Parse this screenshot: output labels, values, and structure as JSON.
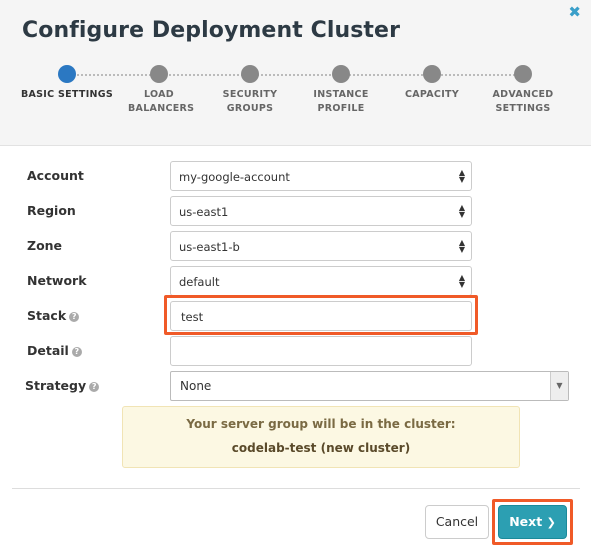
{
  "header": {
    "title": "Configure Deployment Cluster",
    "close_icon": "close-icon"
  },
  "wizard": {
    "steps": [
      {
        "label": "BASIC SETTINGS",
        "active": true
      },
      {
        "label": "LOAD BALANCERS",
        "active": false
      },
      {
        "label": "SECURITY GROUPS",
        "active": false
      },
      {
        "label": "INSTANCE PROFILE",
        "active": false
      },
      {
        "label": "CAPACITY",
        "active": false
      },
      {
        "label": "ADVANCED SETTINGS",
        "active": false
      }
    ]
  },
  "form": {
    "account": {
      "label": "Account",
      "value": "my-google-account"
    },
    "region": {
      "label": "Region",
      "value": "us-east1"
    },
    "zone": {
      "label": "Zone",
      "value": "us-east1-b"
    },
    "network": {
      "label": "Network",
      "value": "default"
    },
    "stack": {
      "label": "Stack",
      "value": "test"
    },
    "detail": {
      "label": "Detail",
      "value": ""
    },
    "strategy": {
      "label": "Strategy",
      "value": "None"
    }
  },
  "notice": {
    "line1": "Your server group will be in the cluster:",
    "line2": "codelab-test (new cluster)"
  },
  "footer": {
    "cancel_label": "Cancel",
    "next_label": "Next"
  },
  "colors": {
    "active_step": "#2b78c2",
    "highlight": "#f05a28",
    "next_button": "#2c9fb2",
    "close_icon": "#3a9fc9"
  }
}
